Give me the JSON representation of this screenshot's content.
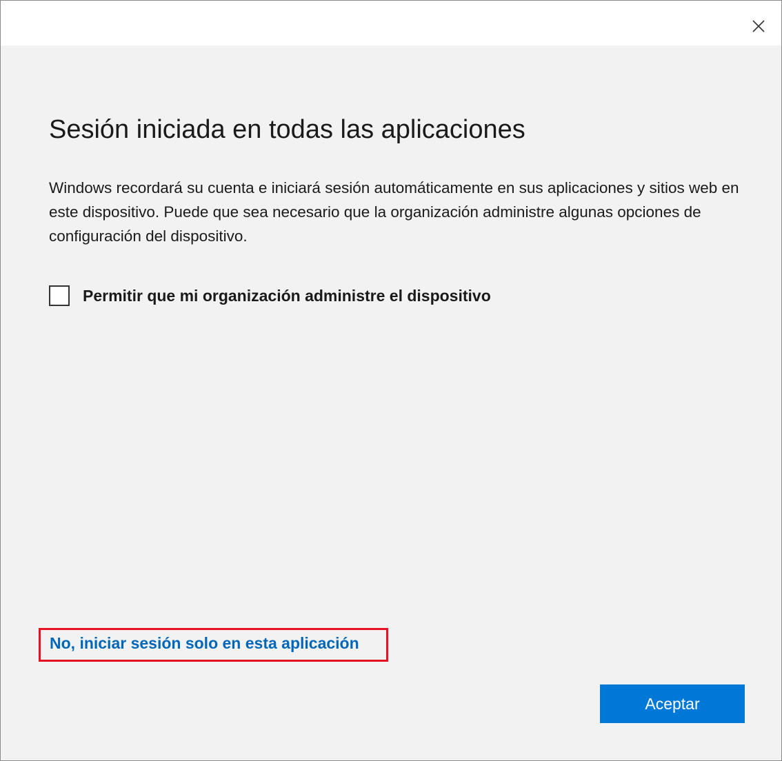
{
  "titlebar": {
    "close_icon": "close-icon"
  },
  "content": {
    "heading": "Sesión iniciada en todas las aplicaciones",
    "description": "Windows recordará su cuenta e iniciará sesión automáticamente en sus aplicaciones y sitios web en este dispositivo. Puede que sea necesario que la organización administre algunas opciones de configuración del dispositivo.",
    "checkbox": {
      "label": "Permitir que mi organización administre el dispositivo",
      "checked": false
    },
    "alt_link": "No, iniciar sesión solo en esta aplicación",
    "accept_button": "Aceptar"
  },
  "colors": {
    "accent": "#0078d7",
    "link": "#0067b8",
    "highlight_frame": "#e81123",
    "background": "#f2f2f2"
  }
}
